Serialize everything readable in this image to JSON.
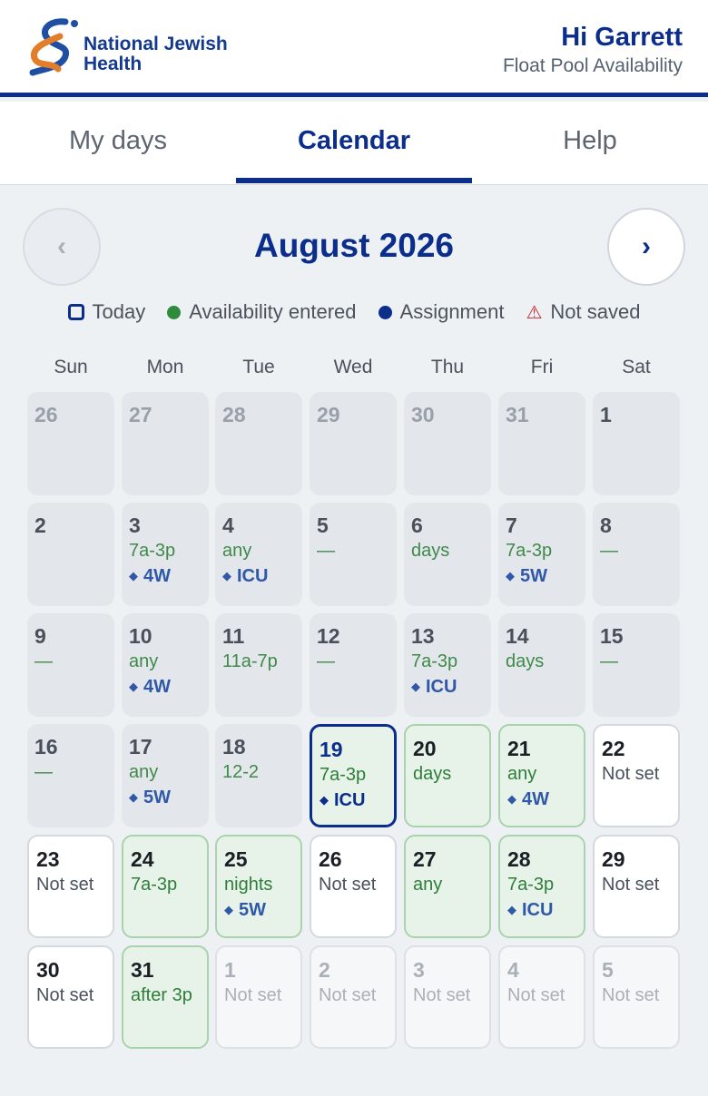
{
  "header": {
    "logo_text_line1": "National Jewish",
    "logo_text_line2": "Health",
    "greeting": "Hi Garrett",
    "subtitle": "Float Pool Availability"
  },
  "tabs": [
    {
      "label": "My days",
      "active": false
    },
    {
      "label": "Calendar",
      "active": true
    },
    {
      "label": "Help",
      "active": false
    }
  ],
  "calendar": {
    "month_label": "August 2026",
    "prev_icon": "‹",
    "next_icon": "›",
    "legend": [
      {
        "label": "Today",
        "icon": "today-square-icon"
      },
      {
        "label": "Availability entered",
        "icon": "green-dot-icon",
        "color": "#2e8b3e"
      },
      {
        "label": "Assignment",
        "icon": "blue-dot-icon",
        "color": "#0b2d8c"
      },
      {
        "label": "Not saved",
        "icon": "warning-triangle-icon",
        "color": "#c0262d"
      }
    ],
    "weekdays": [
      "Sun",
      "Mon",
      "Tue",
      "Wed",
      "Thu",
      "Fri",
      "Sat"
    ],
    "days": [
      {
        "n": "26",
        "kind": "outprev"
      },
      {
        "n": "27",
        "kind": "outprev"
      },
      {
        "n": "28",
        "kind": "outprev"
      },
      {
        "n": "29",
        "kind": "outprev"
      },
      {
        "n": "30",
        "kind": "outprev"
      },
      {
        "n": "31",
        "kind": "outprev"
      },
      {
        "n": "1",
        "kind": "past"
      },
      {
        "n": "2",
        "kind": "past"
      },
      {
        "n": "3",
        "kind": "past",
        "text": "7a-3p",
        "assign": "4W"
      },
      {
        "n": "4",
        "kind": "past",
        "text": "any",
        "assign": "ICU"
      },
      {
        "n": "5",
        "kind": "past",
        "text": "—",
        "dash": true
      },
      {
        "n": "6",
        "kind": "past",
        "text": "days"
      },
      {
        "n": "7",
        "kind": "past",
        "text": "7a-3p",
        "assign": "5W"
      },
      {
        "n": "8",
        "kind": "past",
        "text": "—",
        "dash": true
      },
      {
        "n": "9",
        "kind": "past",
        "text": "—",
        "dash": true
      },
      {
        "n": "10",
        "kind": "past",
        "text": "any",
        "assign": "4W"
      },
      {
        "n": "11",
        "kind": "past",
        "text": "11a-7p"
      },
      {
        "n": "12",
        "kind": "past",
        "text": "—",
        "dash": true
      },
      {
        "n": "13",
        "kind": "past",
        "text": "7a-3p",
        "assign": "ICU"
      },
      {
        "n": "14",
        "kind": "past",
        "text": "days"
      },
      {
        "n": "15",
        "kind": "past",
        "text": "—",
        "dash": true
      },
      {
        "n": "16",
        "kind": "past",
        "text": "—",
        "dash": true
      },
      {
        "n": "17",
        "kind": "past",
        "text": "any",
        "assign": "5W"
      },
      {
        "n": "18",
        "kind": "past",
        "text": "12-2"
      },
      {
        "n": "19",
        "kind": "today",
        "text": "7a-3p",
        "assign": "ICU"
      },
      {
        "n": "20",
        "kind": "avail",
        "text": "days"
      },
      {
        "n": "21",
        "kind": "avail",
        "text": "any",
        "assign": "4W"
      },
      {
        "n": "22",
        "kind": "notset",
        "text": "Not set"
      },
      {
        "n": "23",
        "kind": "notset",
        "text": "Not set"
      },
      {
        "n": "24",
        "kind": "avail",
        "text": "7a-3p"
      },
      {
        "n": "25",
        "kind": "avail",
        "text": "nights",
        "assign": "5W"
      },
      {
        "n": "26",
        "kind": "notset",
        "text": "Not set"
      },
      {
        "n": "27",
        "kind": "avail",
        "text": "any"
      },
      {
        "n": "28",
        "kind": "avail",
        "text": "7a-3p",
        "assign": "ICU"
      },
      {
        "n": "29",
        "kind": "notset",
        "text": "Not set"
      },
      {
        "n": "30",
        "kind": "notset",
        "text": "Not set"
      },
      {
        "n": "31",
        "kind": "avail",
        "text": "after 3p"
      },
      {
        "n": "1",
        "kind": "outnext",
        "text": "Not set"
      },
      {
        "n": "2",
        "kind": "outnext",
        "text": "Not set"
      },
      {
        "n": "3",
        "kind": "outnext",
        "text": "Not set"
      },
      {
        "n": "4",
        "kind": "outnext",
        "text": "Not set"
      },
      {
        "n": "5",
        "kind": "outnext",
        "text": "Not set"
      }
    ]
  }
}
